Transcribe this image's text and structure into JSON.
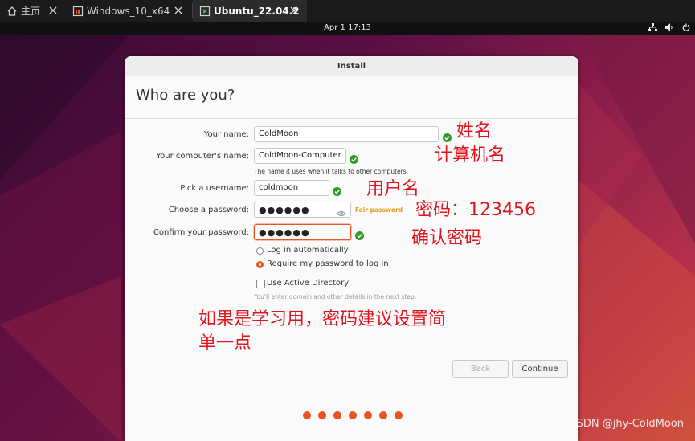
{
  "tabs": [
    {
      "label": "主页",
      "icon": "home-icon"
    },
    {
      "label": "Windows_10_x64",
      "icon": "vm-icon"
    },
    {
      "label": "Ubuntu_22.04.2",
      "icon": "vm-running-icon"
    }
  ],
  "topbar": {
    "clock": "Apr 1  17:13"
  },
  "window": {
    "title": "Install",
    "heading": "Who are you?"
  },
  "form": {
    "name_label": "Your name:",
    "name_value": "ColdMoon",
    "computer_label": "Your computer's name:",
    "computer_value": "ColdMoon-Computer",
    "computer_hint": "The name it uses when it talks to other computers.",
    "username_label": "Pick a username:",
    "username_value": "coldmoon",
    "password_label": "Choose a password:",
    "password_value": "●●●●●●",
    "password_strength": "Fair password",
    "confirm_label": "Confirm your password:",
    "confirm_value": "●●●●●●",
    "login_auto": "Log in automatically",
    "login_password": "Require my password to log in",
    "active_directory": "Use Active Directory",
    "ad_hint": "You'll enter domain and other details in the next step."
  },
  "buttons": {
    "back": "Back",
    "continue": "Continue"
  },
  "annotations": {
    "name": "姓名",
    "computer": "计算机名",
    "username": "用户名",
    "password": "密码：123456",
    "confirm": "确认密码",
    "advice_line1": "如果是学习用，密码建议设置简",
    "advice_line2": "单一点"
  },
  "watermark": "CSDN @jhy-ColdMoon",
  "colors": {
    "accent": "#e95420",
    "check": "#2e9b2e",
    "annotation": "#e0141e"
  }
}
